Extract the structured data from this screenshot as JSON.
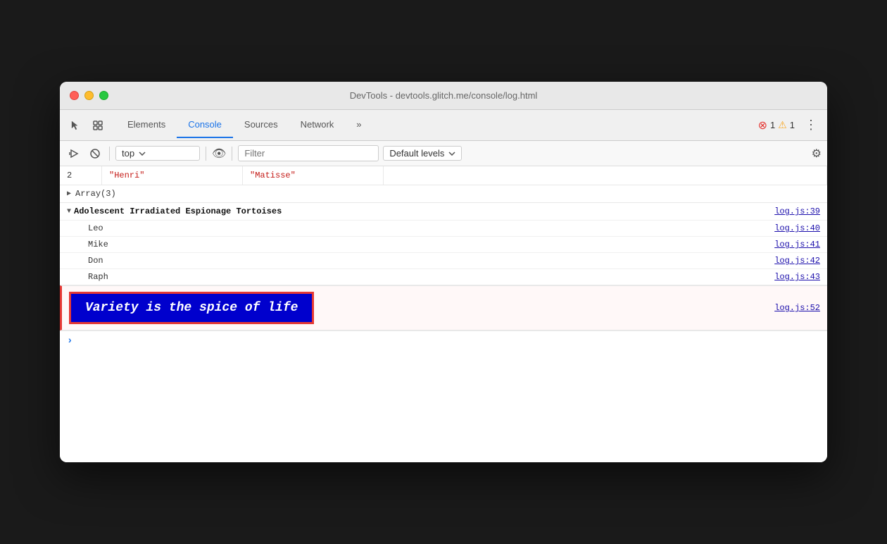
{
  "window": {
    "title": "DevTools - devtools.glitch.me/console/log.html"
  },
  "tabs": {
    "items": [
      {
        "label": "Elements",
        "active": false
      },
      {
        "label": "Console",
        "active": true
      },
      {
        "label": "Sources",
        "active": false
      },
      {
        "label": "Network",
        "active": false
      },
      {
        "label": "»",
        "active": false
      }
    ]
  },
  "badges": {
    "error_count": "1",
    "warn_count": "1"
  },
  "toolbar": {
    "context": "top",
    "filter_placeholder": "Filter",
    "levels": "Default levels"
  },
  "console": {
    "table_row": {
      "index": "2",
      "col1": "\"Henri\"",
      "col2": "\"Matisse\""
    },
    "array_label": "Array(3)",
    "group": {
      "title": "Adolescent Irradiated Espionage Tortoises",
      "source": "log.js:39",
      "items": [
        {
          "text": "Leo",
          "source": "log.js:40"
        },
        {
          "text": "Mike",
          "source": "log.js:41"
        },
        {
          "text": "Don",
          "source": "log.js:42"
        },
        {
          "text": "Raph",
          "source": "log.js:43"
        }
      ]
    },
    "styled_message": "Variety is the spice of life",
    "styled_source": "log.js:52"
  }
}
